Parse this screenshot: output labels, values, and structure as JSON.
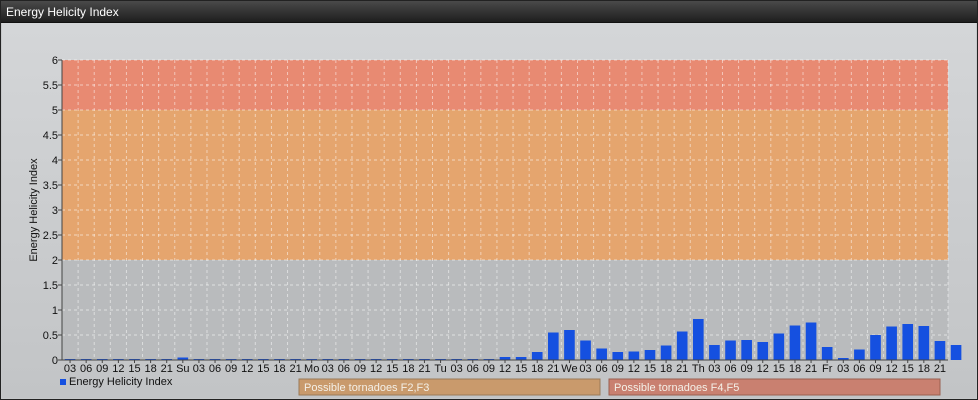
{
  "window": {
    "title": "Energy Helicity Index"
  },
  "colors": {
    "bar": "#1550e0",
    "band_high": "#e88a72",
    "band_mid": "#e5a56e",
    "band_low": "#b9bbbd",
    "legend_band1": "#c99a6c",
    "legend_band2": "#c98070"
  },
  "chart_data": {
    "type": "bar",
    "title": "",
    "xlabel": "",
    "ylabel": "Energy Helicity Index",
    "ylim": [
      0,
      6
    ],
    "yticks": [
      "0",
      "0.5",
      "1",
      "1.5",
      "2",
      "2.5",
      "3",
      "3.5",
      "4",
      "4.5",
      "5",
      "5.5",
      "6"
    ],
    "grid": true,
    "legend_position": "bottom-left",
    "categories": [
      "03",
      "06",
      "09",
      "12",
      "15",
      "18",
      "21",
      "Su",
      "03",
      "06",
      "09",
      "12",
      "15",
      "18",
      "21",
      "Mo",
      "03",
      "06",
      "09",
      "12",
      "15",
      "18",
      "21",
      "Tu",
      "03",
      "06",
      "09",
      "12",
      "15",
      "18",
      "21",
      "We",
      "03",
      "06",
      "09",
      "12",
      "15",
      "18",
      "21",
      "Th",
      "03",
      "06",
      "09",
      "12",
      "15",
      "18",
      "21",
      "Fr",
      "03",
      "06",
      "09",
      "12",
      "15",
      "18",
      "21"
    ],
    "series": [
      {
        "name": "Energy Helicity Index",
        "values": [
          0.02,
          0.02,
          0.02,
          0.02,
          0.02,
          0.02,
          0.02,
          0.05,
          0.02,
          0.02,
          0.02,
          0.02,
          0.02,
          0.02,
          0.02,
          0.02,
          0.02,
          0.02,
          0.02,
          0.02,
          0.02,
          0.02,
          0.02,
          0.02,
          0.02,
          0.02,
          0.02,
          0.06,
          0.06,
          0.16,
          0.55,
          0.6,
          0.39,
          0.23,
          0.16,
          0.17,
          0.2,
          0.29,
          0.57,
          0.82,
          0.3,
          0.39,
          0.4,
          0.36,
          0.53,
          0.69,
          0.75,
          0.26,
          0.04,
          0.21,
          0.5,
          0.67,
          0.72,
          0.68,
          0.38,
          0.3
        ]
      }
    ],
    "bands": [
      {
        "from": 0,
        "to": 2,
        "label": ""
      },
      {
        "from": 2,
        "to": 5,
        "label": "Possible tornadoes F2,F3"
      },
      {
        "from": 5,
        "to": 6,
        "label": "Possible tornadoes F4,F5"
      }
    ]
  }
}
